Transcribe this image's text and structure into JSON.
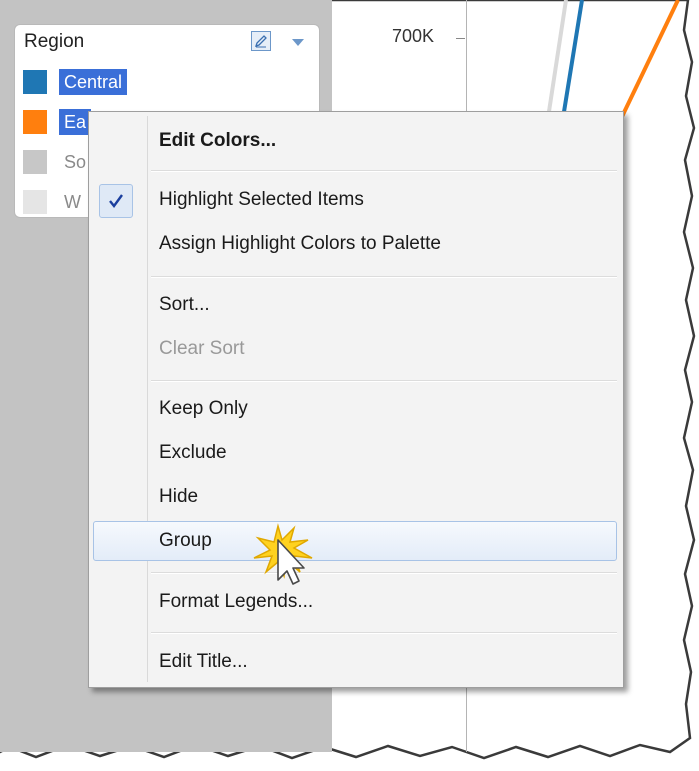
{
  "legend": {
    "title": "Region",
    "edit_icon": "pencil-icon",
    "menu_icon": "chevron-down-icon",
    "items": [
      {
        "label": "Central",
        "color": "#1f77b4",
        "selected": true
      },
      {
        "label": "Ea",
        "color": "#ff7f0e",
        "selected": true
      },
      {
        "label": "So",
        "color": "#c7c7c7",
        "selected": false
      },
      {
        "label": "W",
        "color": "#e5e5e5",
        "selected": false
      }
    ]
  },
  "chart": {
    "y_tick_label": "700K",
    "line_colors": [
      "#1f77b4",
      "#ff7f0e",
      "#d9d9d9"
    ]
  },
  "context_menu": {
    "items": [
      {
        "label": "Edit Colors...",
        "bold": true
      },
      {
        "label": "Highlight Selected Items",
        "checked": true
      },
      {
        "label": "Assign Highlight Colors to Palette"
      },
      {
        "label": "Sort..."
      },
      {
        "label": "Clear Sort",
        "disabled": true
      },
      {
        "label": "Keep Only"
      },
      {
        "label": "Exclude"
      },
      {
        "label": "Hide"
      },
      {
        "label": "Group",
        "hovered": true
      },
      {
        "label": "Format Legends..."
      },
      {
        "label": "Edit Title..."
      }
    ]
  },
  "colors": {
    "selection": "#3a6fd8",
    "check": "#1b3f9e",
    "highlight_border": "#a8c3e6",
    "panel_gray": "#c3c3c3"
  }
}
